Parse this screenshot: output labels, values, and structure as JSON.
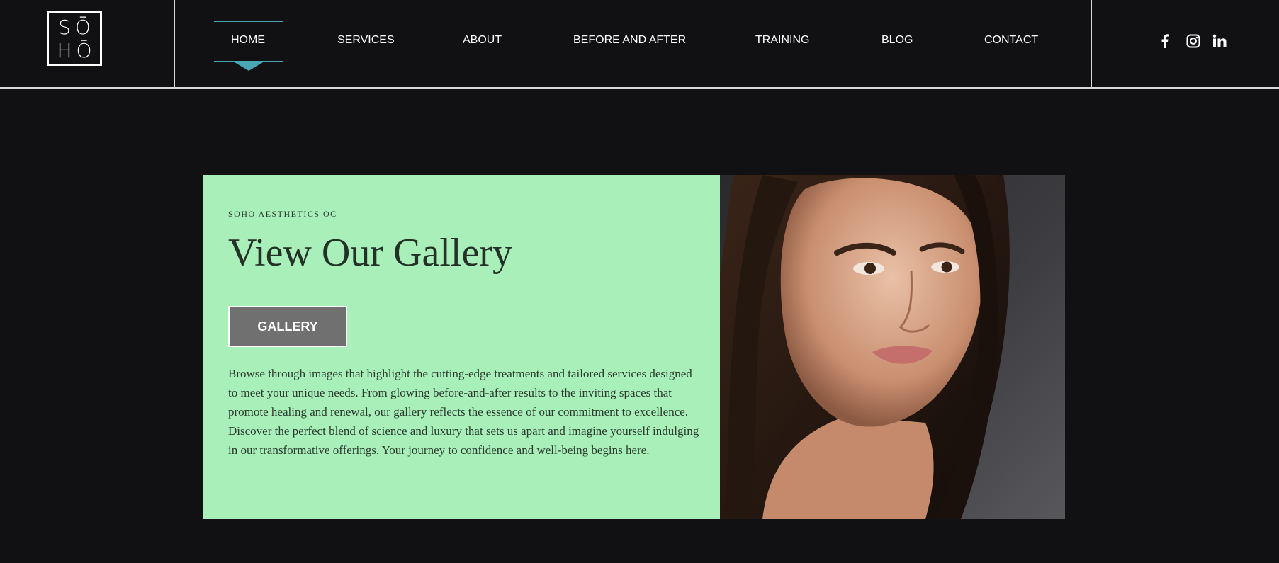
{
  "brand": {
    "logo_top": "SŌ",
    "logo_bottom": "HŌ"
  },
  "nav": {
    "items": [
      {
        "label": "HOME",
        "active": true
      },
      {
        "label": "SERVICES"
      },
      {
        "label": "ABOUT"
      },
      {
        "label": "BEFORE AND AFTER"
      },
      {
        "label": "TRAINING"
      },
      {
        "label": "BLOG"
      },
      {
        "label": "CONTACT"
      }
    ]
  },
  "social": {
    "icons": [
      "facebook-icon",
      "instagram-icon",
      "linkedin-icon"
    ]
  },
  "hero": {
    "eyebrow": "SOHO AESTHETICS OC",
    "title": "View Our Gallery",
    "button_label": "GALLERY",
    "description": "Browse through images that highlight the cutting-edge treatments and tailored services designed to meet your unique needs. From glowing before-and-after results to the inviting spaces that promote healing and renewal, our gallery reflects the essence of our commitment to excellence. Discover the perfect blend of science and luxury that sets us apart and imagine yourself indulging in our transformative offerings. Your journey to confidence and well-being begins here."
  },
  "colors": {
    "background": "#111114",
    "accent": "#4aa6b5",
    "hero_panel": "#a8efba",
    "button": "#707070"
  }
}
